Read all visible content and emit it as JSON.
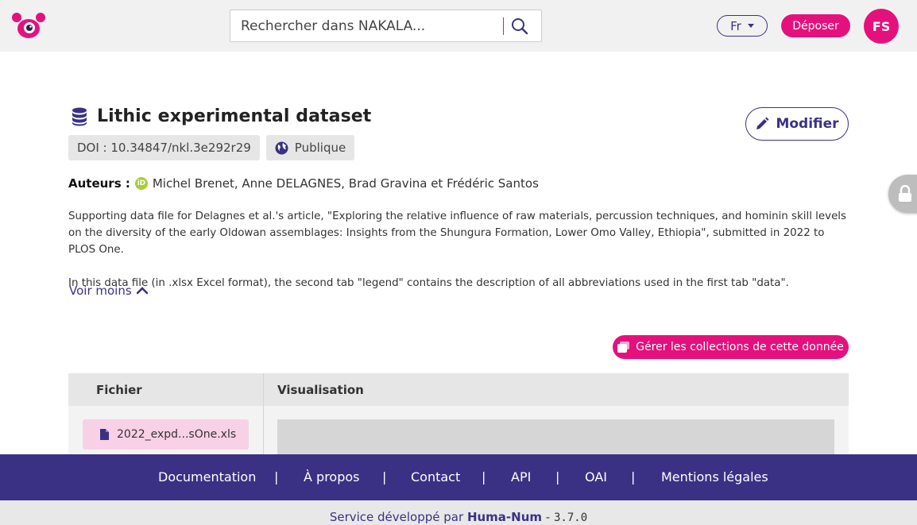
{
  "header": {
    "search_placeholder": "Rechercher dans NAKALA...",
    "lang": "Fr",
    "deposit_label": "Déposer",
    "user_initials": "FS"
  },
  "record": {
    "title": "Lithic experimental dataset",
    "doi_label": "DOI : 10.34847/nkl.3e292r29",
    "visibility": "Publique",
    "edit_label": "Modifier",
    "authors_label": "Auteurs :",
    "authors": "Michel Brenet, Anne DELAGNES, Brad Gravina et Frédéric Santos",
    "description_p1": "Supporting data file for Delagnes et al.'s article, \"Exploring the relative influence of raw materials, percussion techniques, and hominin skill levels on the diversity of the early Oldowan assemblages: Insights from the Shungura Formation, Lower Omo Valley, Ethiopia\", submitted in 2022 to PLOS One.",
    "description_p2": "In this data file (in .xlsx Excel format), the second tab \"legend\" contains the description of all abbreviations used in the first tab \"data\".",
    "toggle_label": "Voir moins",
    "collections_label": "Gérer les collections de cette donnée"
  },
  "files_table": {
    "col_file": "Fichier",
    "col_preview": "Visualisation",
    "files": [
      {
        "name": "2022_expd...sOne.xls"
      }
    ]
  },
  "footer": {
    "links": [
      "Documentation",
      "À propos",
      "Contact",
      "API",
      "OAI",
      "Mentions légales"
    ],
    "separator": "|",
    "credit_prefix": "Service développé par",
    "credit_org": "Huma-Num",
    "credit_dash": "-",
    "version": "3.7.0"
  },
  "colors": {
    "brand_pink": "#e4117d",
    "brand_indigo": "#3a3185"
  }
}
